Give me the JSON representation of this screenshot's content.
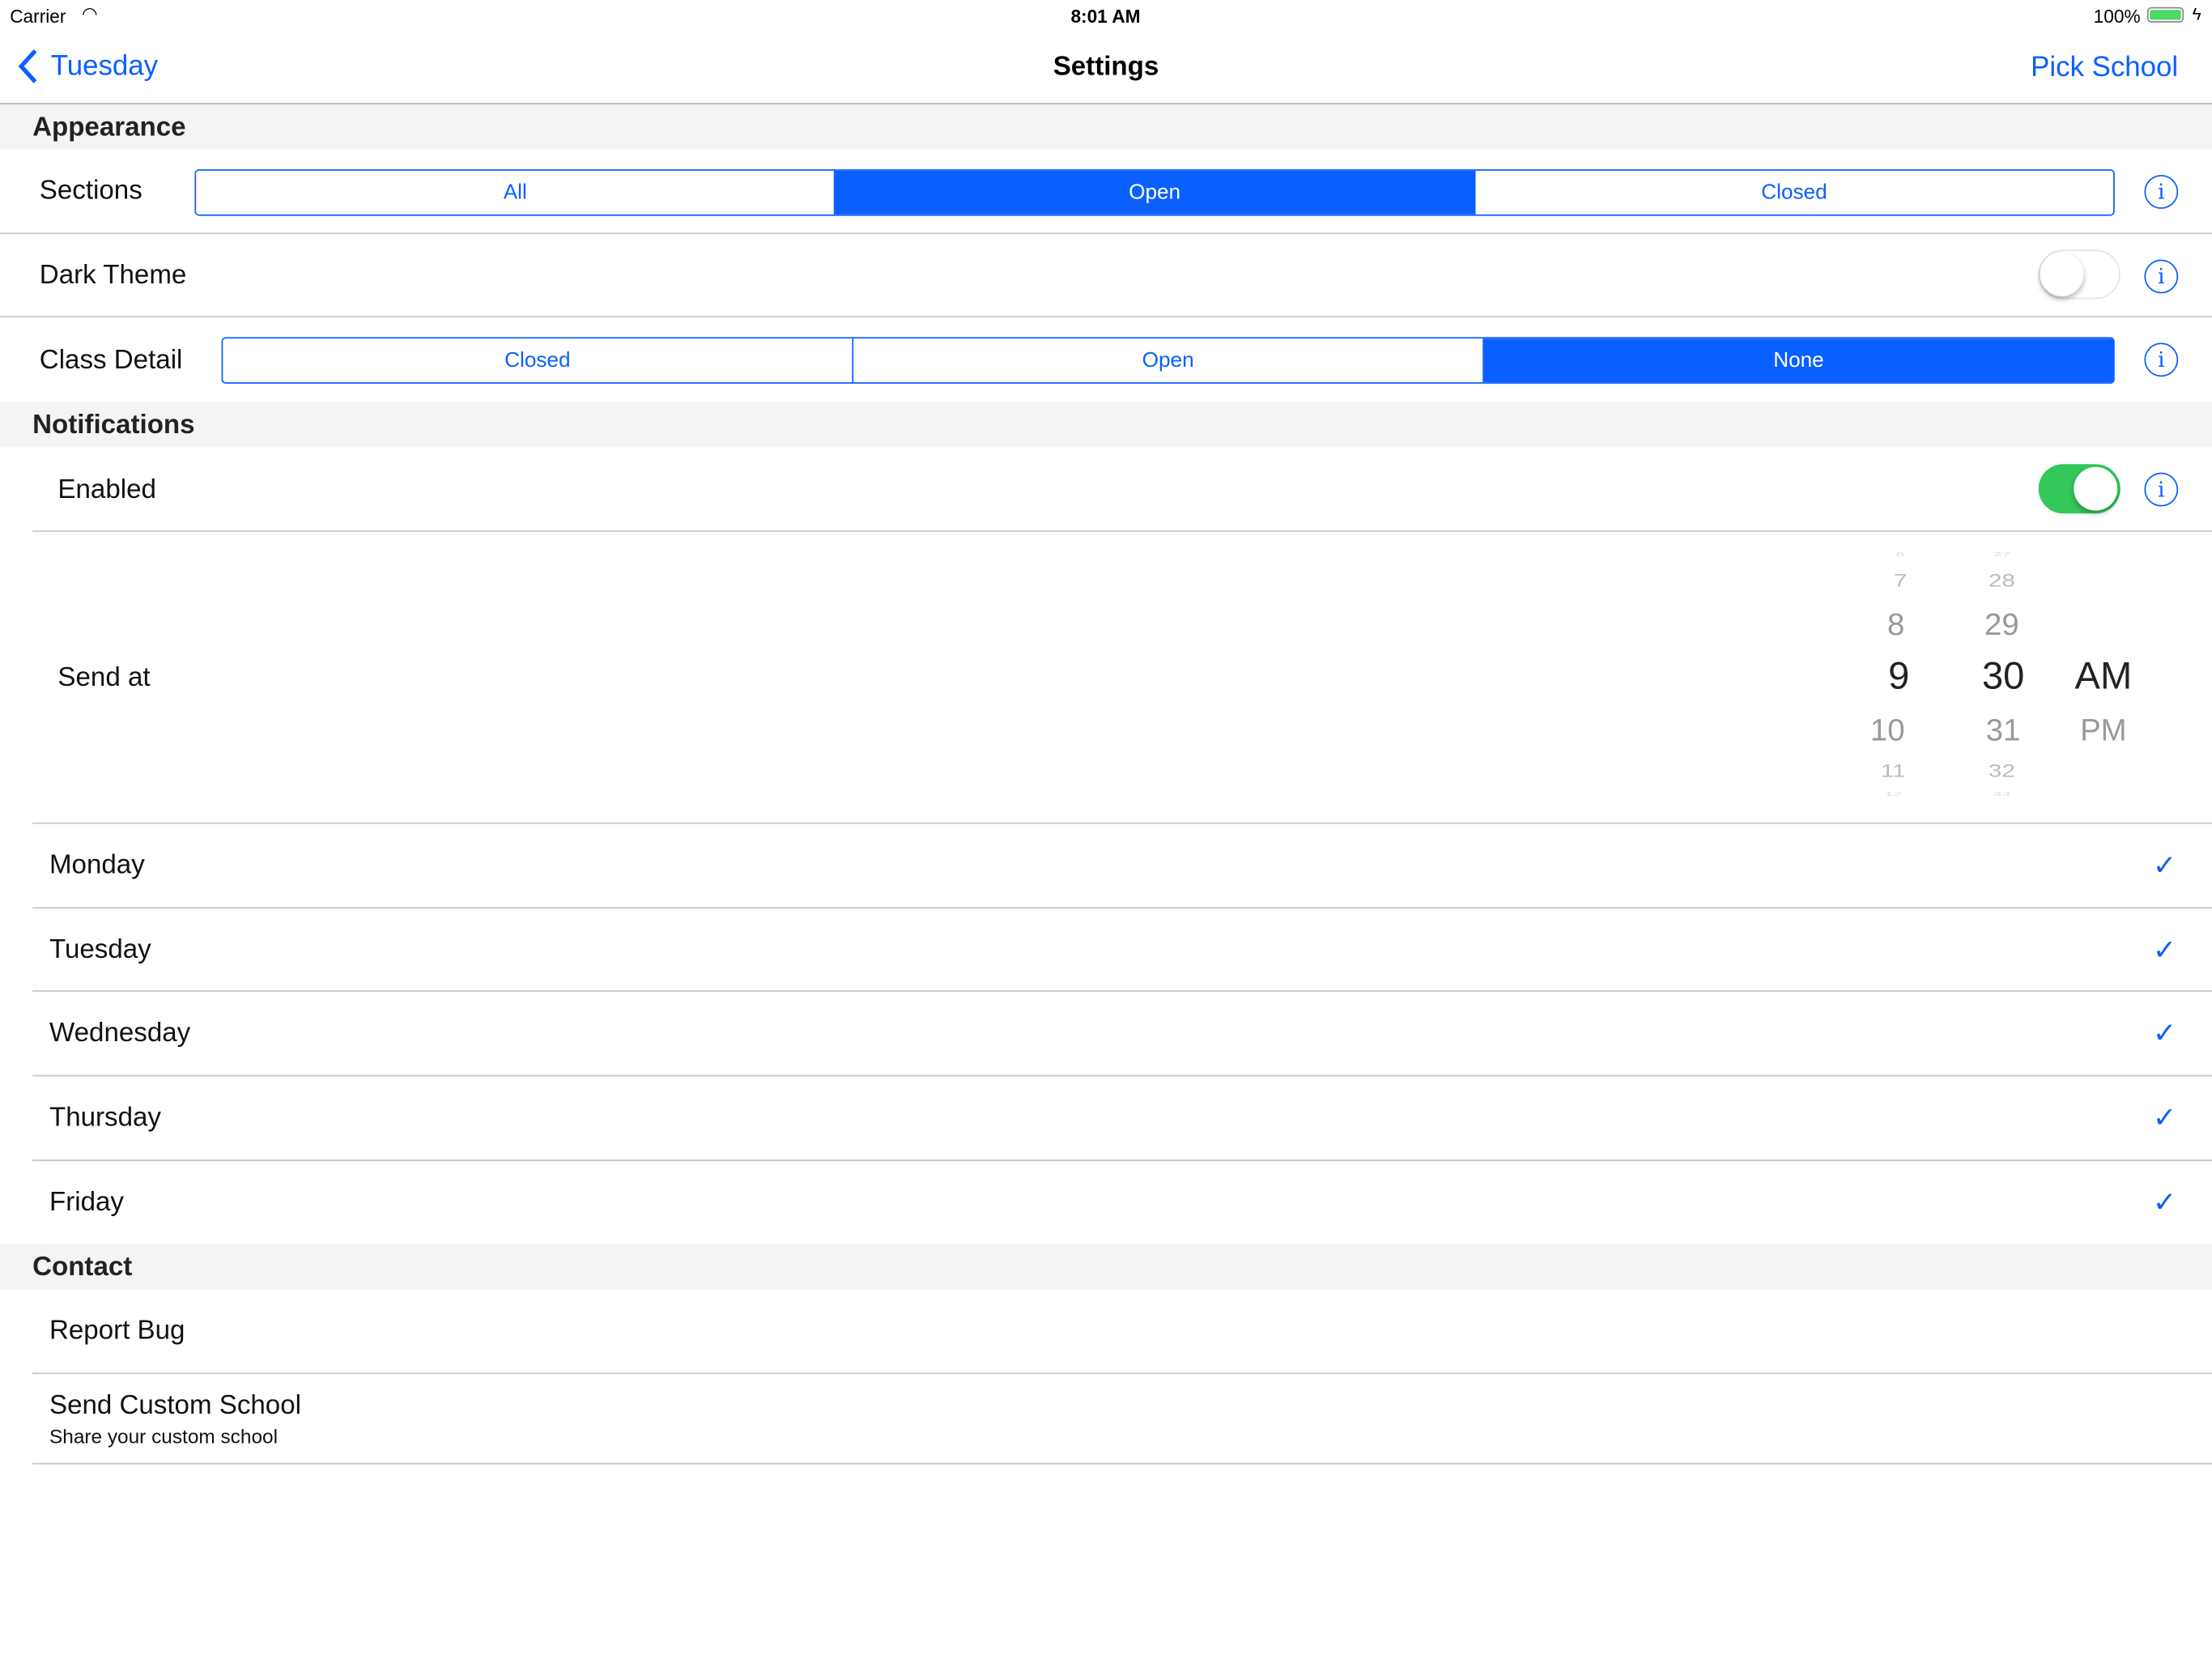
{
  "status_bar": {
    "carrier": "Carrier",
    "time": "8:01 AM",
    "battery": "100%"
  },
  "nav": {
    "back_label": "Tuesday",
    "title": "Settings",
    "right_label": "Pick School"
  },
  "colors": {
    "accent": "#0a60ff",
    "toggle_on": "#34c759"
  },
  "appearance": {
    "header": "Appearance",
    "sections": {
      "label": "Sections",
      "options": [
        "All",
        "Open",
        "Closed"
      ],
      "selected": "Open"
    },
    "dark_theme": {
      "label": "Dark Theme",
      "on": false
    },
    "class_detail": {
      "label": "Class Detail",
      "options": [
        "Closed",
        "Open",
        "None"
      ],
      "selected": "None"
    }
  },
  "notifications": {
    "header": "Notifications",
    "enabled": {
      "label": "Enabled",
      "on": true
    },
    "send_at": {
      "label": "Send at",
      "hours": [
        "6",
        "7",
        "8",
        "9",
        "10",
        "11",
        "12"
      ],
      "minutes": [
        "27",
        "28",
        "29",
        "30",
        "31",
        "32",
        "33"
      ],
      "periods": [
        "AM",
        "PM"
      ],
      "selected": {
        "hour": "9",
        "minute": "30",
        "period": "AM"
      }
    },
    "days": [
      {
        "label": "Monday",
        "checked": true
      },
      {
        "label": "Tuesday",
        "checked": true
      },
      {
        "label": "Wednesday",
        "checked": true
      },
      {
        "label": "Thursday",
        "checked": true
      },
      {
        "label": "Friday",
        "checked": true
      }
    ]
  },
  "contact": {
    "header": "Contact",
    "report_bug": "Report Bug",
    "custom_school": {
      "title": "Send Custom School",
      "subtitle": "Share your custom school"
    }
  }
}
